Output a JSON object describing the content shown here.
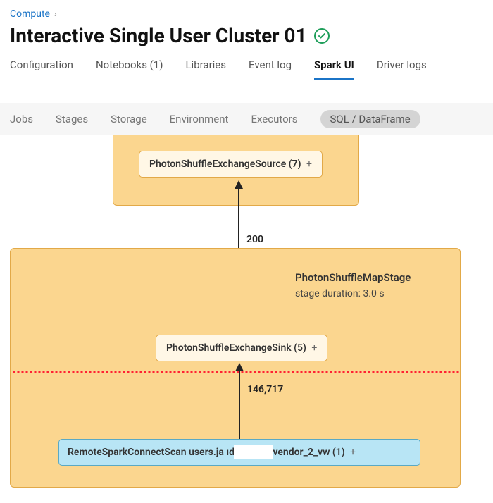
{
  "breadcrumb": {
    "parent": "Compute"
  },
  "title": "Interactive Single User Cluster 01",
  "main_tabs": [
    {
      "label": "Configuration",
      "active": false
    },
    {
      "label": "Notebooks (1)",
      "active": false
    },
    {
      "label": "Libraries",
      "active": false
    },
    {
      "label": "Event log",
      "active": false
    },
    {
      "label": "Spark UI",
      "active": true
    },
    {
      "label": "Driver logs",
      "active": false
    }
  ],
  "spark_tabs": [
    {
      "label": "Jobs",
      "active": false
    },
    {
      "label": "Stages",
      "active": false
    },
    {
      "label": "Storage",
      "active": false
    },
    {
      "label": "Environment",
      "active": false
    },
    {
      "label": "Executors",
      "active": false
    },
    {
      "label": "SQL / DataFrame",
      "active": true
    }
  ],
  "diagram": {
    "top_node": "PhotonShuffleExchangeSource (7)",
    "bottom_stage_title": "PhotonShuffleMapStage",
    "bottom_stage_sub": "stage duration: 3.0 s",
    "sink_node": "PhotonShuffleExchangeSink (5)",
    "scan_node": "RemoteSparkConnectScan users.ja        ıd.fs_prpr_vendor_2_vw (1)",
    "edge_top": "200",
    "edge_bottom": "146,717"
  }
}
